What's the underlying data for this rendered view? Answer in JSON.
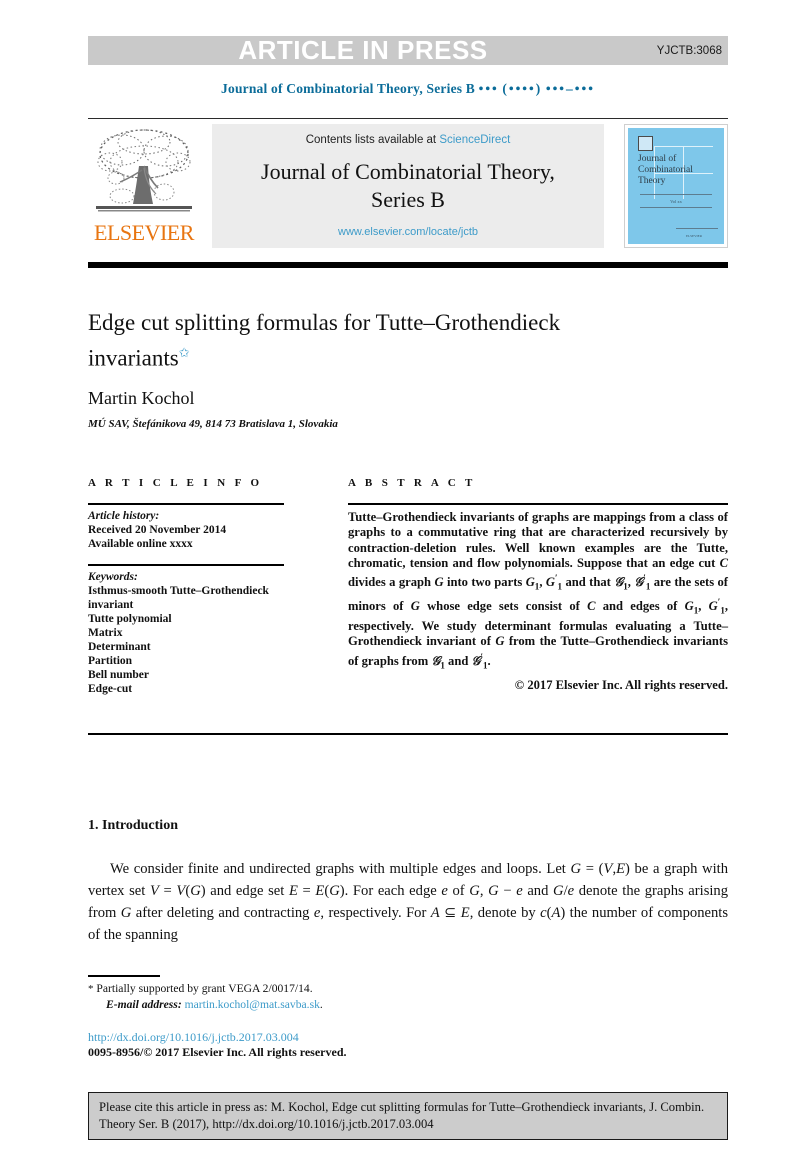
{
  "banner": {
    "label": "ARTICLE IN PRESS",
    "code": "YJCTB:3068",
    "bg_color": "#c9c9c9",
    "text_color": "#ffffff"
  },
  "running_head": {
    "journal": "Journal of Combinatorial Theory, Series B",
    "volume_placeholder": "•••",
    "year_placeholder": "(••••)",
    "pages_placeholder": "•••–•••",
    "color": "#0b6c99"
  },
  "masthead": {
    "contents_prefix": "Contents lists available at",
    "contents_link": "ScienceDirect",
    "journal_title_line1": "Journal of Combinatorial Theory,",
    "journal_title_line2": "Series B",
    "journal_url": "www.elsevier.com/locate/jctb",
    "publisher": "ELSEVIER",
    "publisher_color": "#e87511",
    "link_color": "#3d9bc9",
    "panel_bg": "#ececec",
    "cover": {
      "title_line1": "Journal of",
      "title_line2": "Combinatorial",
      "title_line3": "Theory",
      "volume_text": "Vol xx",
      "footer_text": "ELSEVIER",
      "bg_color": "#7ec7ea"
    }
  },
  "article": {
    "title": "Edge cut splitting formulas for Tutte–Grothendieck invariants",
    "title_footnote_marker": "✩",
    "author": "Martin Kochol",
    "affiliation": "MÚ SAV, Štefánikova 49, 814 73 Bratislava 1, Slovakia"
  },
  "info_column": {
    "heading": "A R T I C L E   I N F O",
    "history_label": "Article history:",
    "history": [
      "Received 20 November 2014",
      "Available online xxxx"
    ],
    "keywords_label": "Keywords:",
    "keywords": [
      "Isthmus-smooth Tutte–Grothendieck",
      "invariant",
      "Tutte polynomial",
      "Matrix",
      "Determinant",
      "Partition",
      "Bell number",
      "Edge-cut"
    ]
  },
  "abstract_column": {
    "heading": "A B S T R A C T",
    "copyright": "© 2017 Elsevier Inc. All rights reserved."
  },
  "body": {
    "section_number_title": "1. Introduction"
  },
  "footnote": {
    "marker": "*",
    "grant": "Partially supported by grant VEGA 2/0017/14.",
    "email_label": "E-mail address:",
    "email": "martin.kochol@mat.savba.sk",
    "email_trailing": ".",
    "link_color": "#3d9bc9"
  },
  "publication": {
    "doi_url": "http://dx.doi.org/10.1016/j.jctb.2017.03.004",
    "issn_line": "0095-8956/© 2017 Elsevier Inc. All rights reserved."
  },
  "citation_box": {
    "line1": "Please cite this article in press as: M. Kochol, Edge cut splitting formulas for Tutte–Grothendieck",
    "line2": "invariants, J. Combin. Theory Ser. B (2017), http://dx.doi.org/10.1016/j.jctb.2017.03.004",
    "bg_color": "#cccccc"
  }
}
